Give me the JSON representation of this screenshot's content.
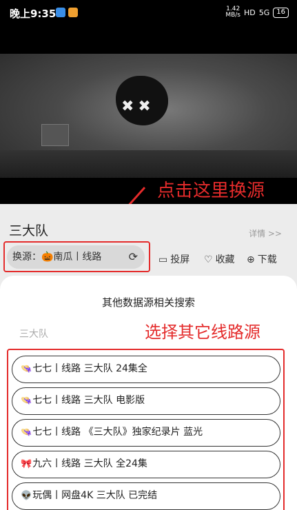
{
  "status_bar": {
    "time": "晚上9:35",
    "net_speed_top": "1.42",
    "net_speed_bottom": "MB/s",
    "hd": "HD",
    "signal": "5G",
    "battery": "16"
  },
  "video": {
    "annotation": "点击这里换源"
  },
  "detail": {
    "title": "三大队",
    "details_link": "详情 >>",
    "source_label": "换源：🎃南瓜丨线路",
    "actions": [
      {
        "icon": "▭",
        "label": "投屏"
      },
      {
        "icon": "♡",
        "label": "收藏"
      },
      {
        "icon": "⊕",
        "label": "下载"
      }
    ]
  },
  "sheet": {
    "title": "其他数据源相关搜索",
    "search_text": "三大队",
    "annotation": "选择其它线路源",
    "results": [
      {
        "emoji": "👒",
        "text": "七七丨线路  三大队  24集全"
      },
      {
        "emoji": "👒",
        "text": "七七丨线路  三大队 电影版"
      },
      {
        "emoji": "👒",
        "text": "七七丨线路  《三大队》独家纪录片  蓝光"
      },
      {
        "emoji": "🎀",
        "text": "九六丨线路  三大队  全24集"
      },
      {
        "emoji": "👽",
        "text": "玩偶丨网盘4K  三大队  已完结"
      }
    ]
  },
  "colors": {
    "annotation_red": "#e42b2b",
    "sheet_bg": "#ffffff",
    "page_bg": "#ececec"
  }
}
